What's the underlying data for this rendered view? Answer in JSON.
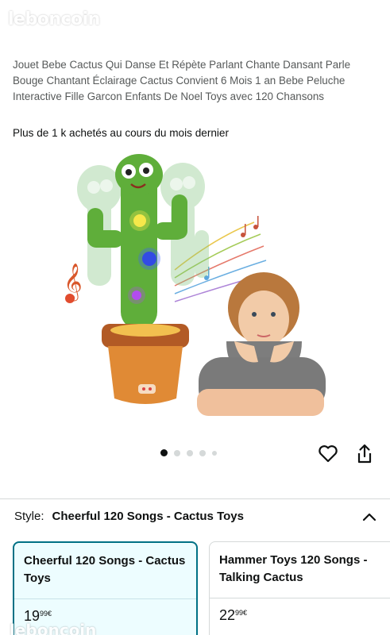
{
  "watermark": "leboncoin",
  "product": {
    "title": "Jouet Bebe Cactus Qui Danse Et Répète Parlant Chante Dansant Parle Bouge Chantant Éclairage Cactus Convient 6 Mois 1 an Bebe Peluche Interactive Fille Garcon Enfants De Noel Toys avec 120 Chansons",
    "social_proof": "Plus de 1 k achetés au cours du mois dernier"
  },
  "gallery": {
    "dot_count": 5,
    "active_index": 0
  },
  "style_selector": {
    "label": "Style:",
    "selected_value": "Cheerful 120 Songs - Cactus Toys",
    "options": [
      {
        "name": "Cheerful 120 Songs - Cactus Toys",
        "price_main": "19",
        "price_cents": "99",
        "currency": "€",
        "selected": true
      },
      {
        "name": "Hammer Toys 120 Songs - Talking Cactus",
        "price_main": "22",
        "price_cents": "99",
        "currency": "€",
        "selected": false
      }
    ]
  },
  "colors": {
    "selected_border": "#007185",
    "selected_bg": "#edfdff",
    "text": "#0f1111",
    "muted": "#565959"
  },
  "icons": [
    "heart-icon",
    "share-icon",
    "chevron-up-icon"
  ]
}
